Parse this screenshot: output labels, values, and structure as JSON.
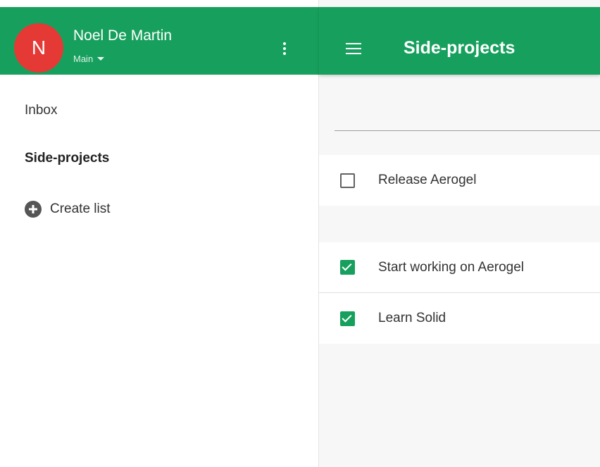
{
  "sidebar": {
    "user_initial": "N",
    "user_name": "Noel De Martin",
    "account": "Main",
    "items": [
      {
        "label": "Inbox"
      },
      {
        "label": "Side-projects"
      }
    ],
    "create_list_label": "Create list"
  },
  "main": {
    "title": "Side-projects",
    "new_task_placeholder": "",
    "pending_tasks": [
      {
        "label": "Release Aerogel",
        "checked": false
      }
    ],
    "completed_tasks": [
      {
        "label": "Start working on Aerogel",
        "checked": true
      },
      {
        "label": "Learn Solid",
        "checked": true
      }
    ]
  },
  "colors": {
    "primary": "#17a05d",
    "avatar": "#e53935"
  },
  "icons": {
    "account_menu": "more-vert-icon",
    "account_dropdown": "caret-down-icon",
    "menu": "hamburger-menu-icon",
    "create_list": "plus-circle-icon"
  }
}
